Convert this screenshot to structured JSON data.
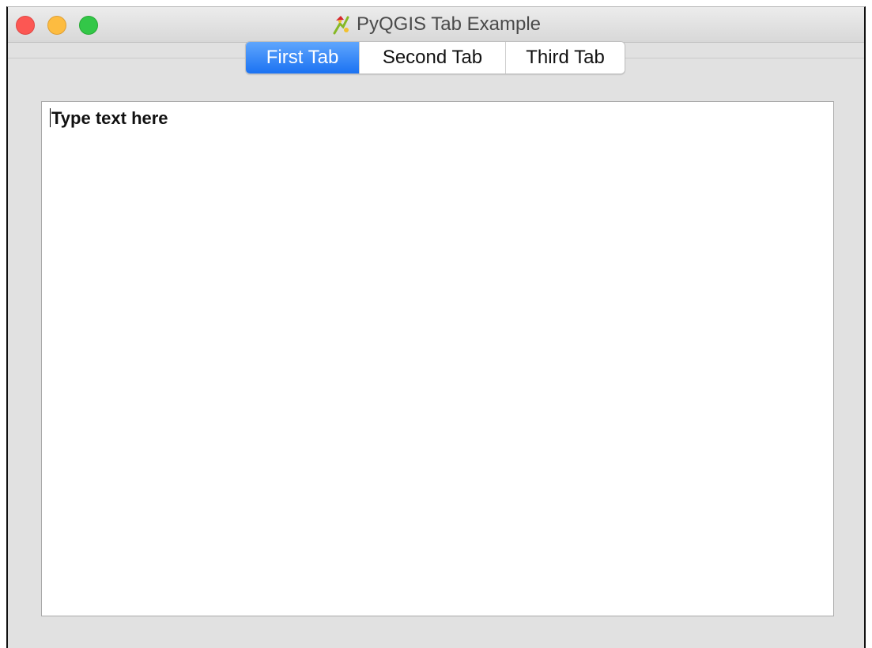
{
  "window": {
    "title": "PyQGIS Tab Example",
    "controls": [
      "close",
      "minimize",
      "zoom"
    ],
    "app_icon": "qgis-icon"
  },
  "tabs": {
    "active_index": 0,
    "items": [
      {
        "label": "First Tab"
      },
      {
        "label": "Second Tab"
      },
      {
        "label": "Third Tab"
      }
    ]
  },
  "editor": {
    "text": "Type text here"
  },
  "colors": {
    "active_tab": "#1b72f2",
    "close": "#fc5753",
    "minimize": "#fdbc40",
    "zoom": "#33c748",
    "window_bg": "#e1e1e1"
  }
}
